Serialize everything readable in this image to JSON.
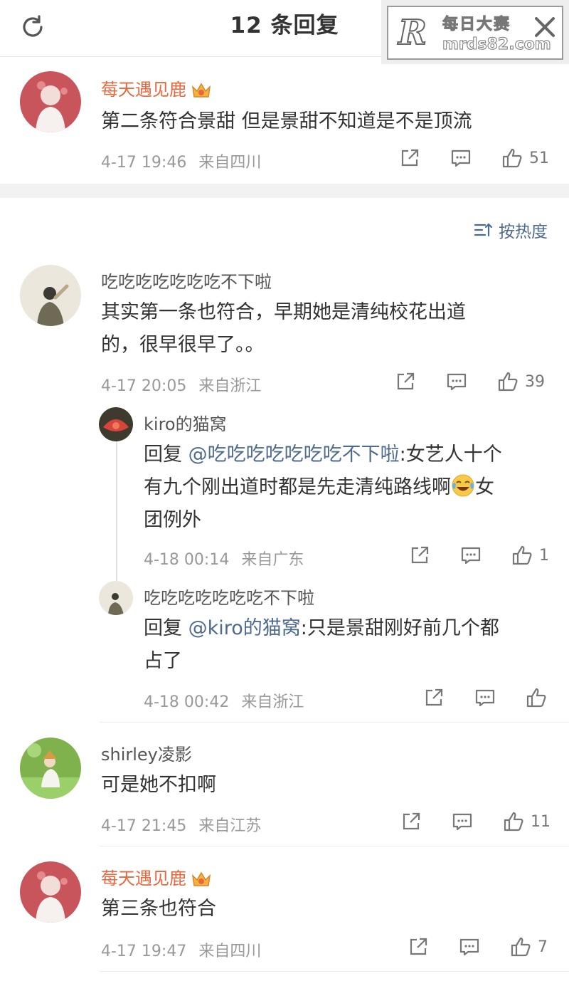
{
  "header": {
    "title": "12 条回复",
    "watermark_line1": "每日大赛",
    "watermark_line2": "mrds82.com",
    "watermark_logo": "R"
  },
  "sort": {
    "label": "按热度"
  },
  "top_comment": {
    "user": "莓天遇见鹿",
    "text": "第二条符合景甜 但是景甜不知道是不是顶流",
    "time": "4-17 19:46",
    "location": "来自四川",
    "likes": "51"
  },
  "comments": [
    {
      "user": "吃吃吃吃吃吃吃不下啦",
      "text_lines": [
        "其实第一条也符合，早期她是清纯校花出道",
        "的，很早很早了。。"
      ],
      "time": "4-17 20:05",
      "location": "来自浙江",
      "likes": "39"
    },
    {
      "user": "shirley凌影",
      "text": "可是她不扣啊",
      "time": "4-17 21:45",
      "location": "来自江苏",
      "likes": "11"
    },
    {
      "user": "莓天遇见鹿",
      "text": "第三条也符合",
      "time": "4-17 19:47",
      "location": "来自四川",
      "likes": "7"
    }
  ],
  "replies": [
    {
      "user": "kiro的猫窝",
      "prefix": "回复 ",
      "mention": "@吃吃吃吃吃吃吃不下啦",
      "line1": ":女艺人十个",
      "line2": "有九个刚出道时都是先走清纯路线啊",
      "line2_tail": "女",
      "line3": "团例外",
      "time": "4-18 00:14",
      "location": "来自广东",
      "likes": "1"
    },
    {
      "user": "吃吃吃吃吃吃吃不下啦",
      "prefix": "回复 ",
      "mention": "@kiro的猫窝",
      "line1": ":只是景甜刚好前几个都",
      "line2": "占了",
      "time": "4-18 00:42",
      "location": "来自浙江",
      "likes": ""
    }
  ],
  "colors": {
    "accent": "#e8673d",
    "link": "#4e6a8e",
    "meta": "#999999"
  }
}
